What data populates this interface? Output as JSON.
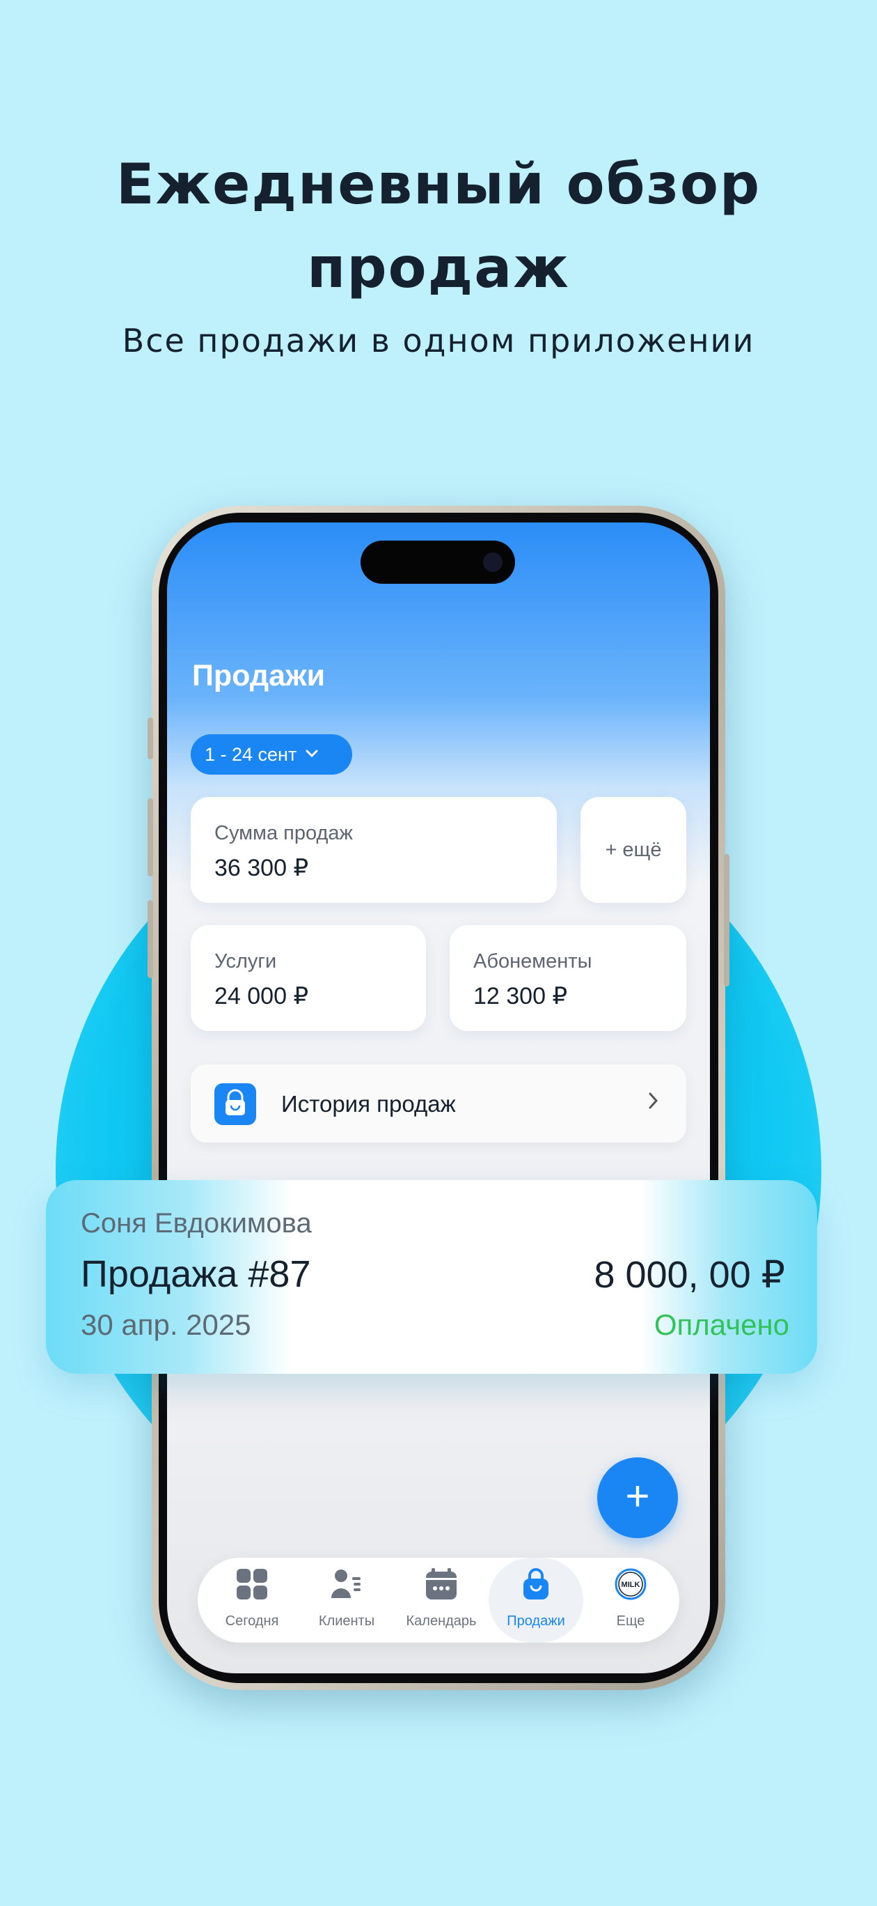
{
  "promo": {
    "headline_line1": "Ежедневный обзор",
    "headline_line2": "продаж",
    "subheadline": "Все продажи в одном приложении"
  },
  "screen": {
    "title": "Продажи",
    "date_filter": "1 - 24 сент",
    "summary": {
      "total_label": "Сумма продаж",
      "total_value": "36 300 ₽",
      "more_label": "+ ещё",
      "services_label": "Услуги",
      "services_value": "24 000 ₽",
      "subscriptions_label": "Абонементы",
      "subscriptions_value": "12 300 ₽"
    },
    "history_label": "История продаж",
    "fab_label": "+",
    "tabs": [
      {
        "label": "Сегодня",
        "icon": "grid-icon"
      },
      {
        "label": "Клиенты",
        "icon": "clients-icon"
      },
      {
        "label": "Календарь",
        "icon": "calendar-icon"
      },
      {
        "label": "Продажи",
        "icon": "shopping-bag-icon",
        "active": true
      },
      {
        "label": "Еще",
        "icon": "milk-logo-icon",
        "logo_text": "MILK"
      }
    ]
  },
  "sale_card": {
    "client": "Соня Евдокимова",
    "title": "Продажа #87",
    "date": "30 апр. 2025",
    "amount": "8 000, 00 ₽",
    "status": "Оплачено"
  },
  "colors": {
    "background": "#bff1fd",
    "accent": "#1a86f4",
    "paid": "#31c25a",
    "text_dark": "#15212f"
  }
}
